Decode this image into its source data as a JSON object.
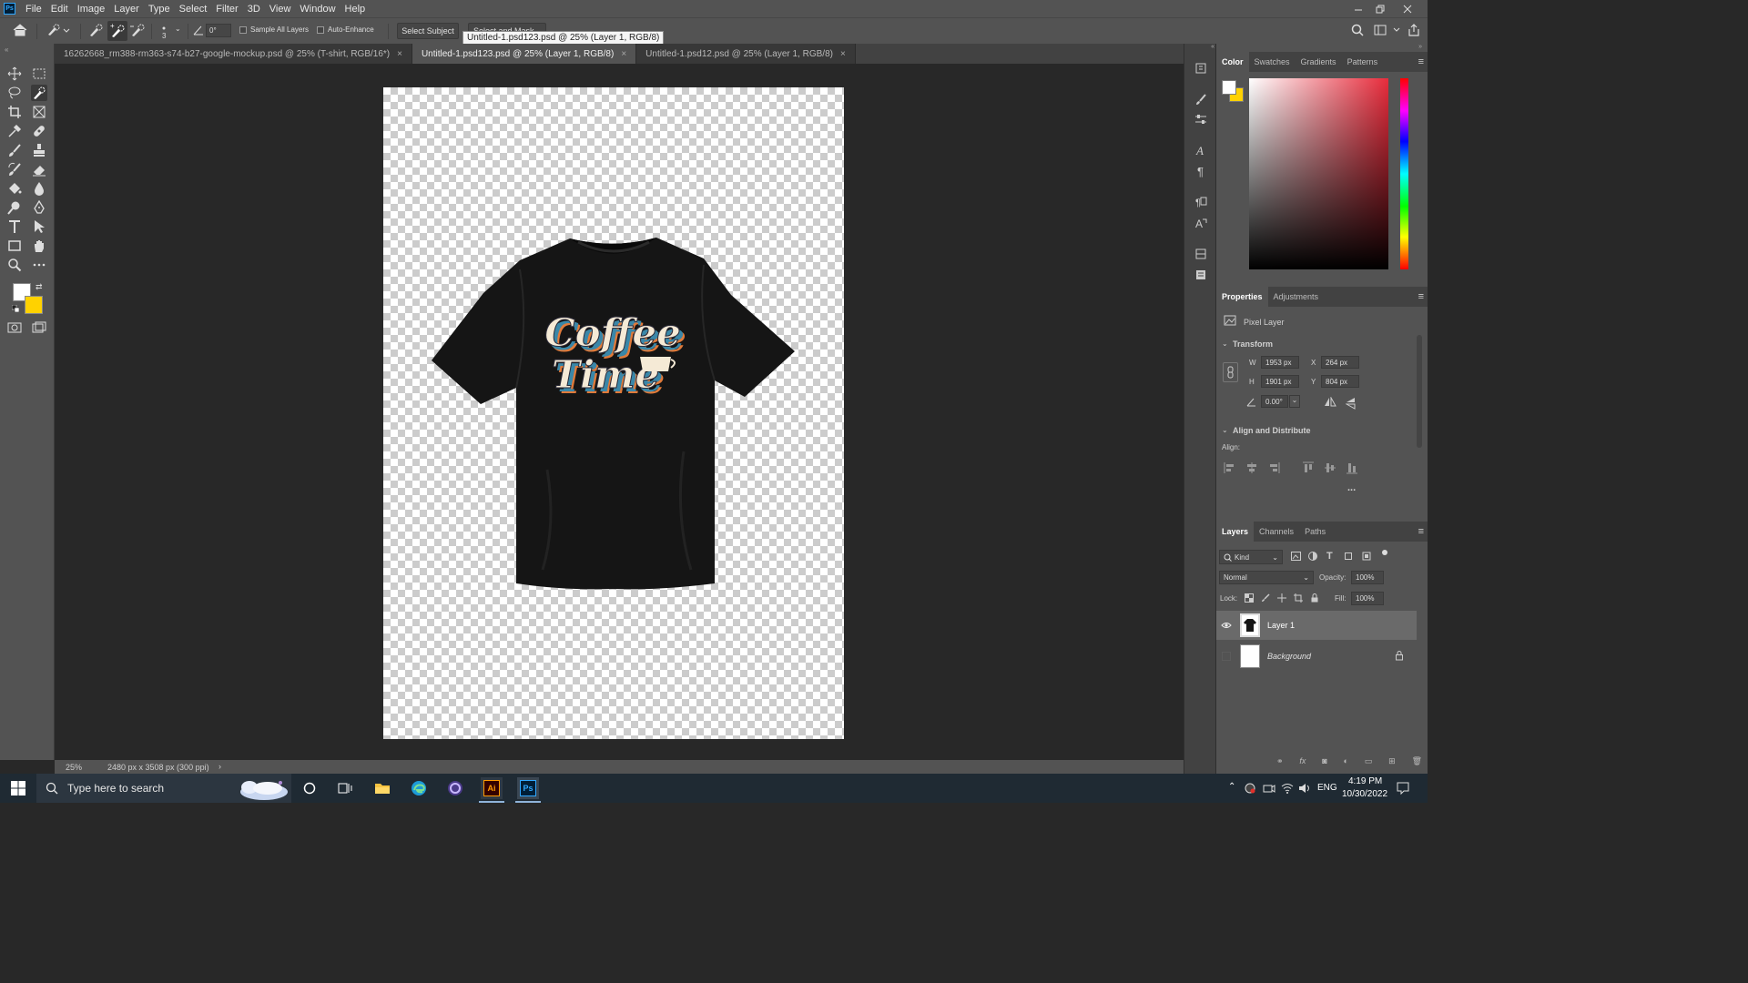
{
  "menubar": {
    "logo": "Ps",
    "items": [
      "File",
      "Edit",
      "Image",
      "Layer",
      "Type",
      "Select",
      "Filter",
      "3D",
      "View",
      "Window",
      "Help"
    ]
  },
  "options": {
    "brush_size": "3",
    "angle": "0°",
    "sample_all_layers": "Sample All Layers",
    "auto_enhance": "Auto-Enhance",
    "select_subject": "Select Subject",
    "select_and_mask": "Select and Mask..."
  },
  "tooltip": "Untitled-1.psd123.psd @ 25% (Layer 1, RGB/8)",
  "tabs": [
    {
      "label": "16262668_rm388-rm363-s74-b27-google-mockup.psd @ 25% (T-shirt, RGB/16*)",
      "close": "×"
    },
    {
      "label": "Untitled-1.psd123.psd @ 25% (Layer 1, RGB/8)",
      "close": "×"
    },
    {
      "label": "Untitled-1.psd12.psd @ 25% (Layer 1, RGB/8)",
      "close": "×"
    }
  ],
  "artwork": {
    "line1": "Coffee",
    "line2": "Time"
  },
  "status": {
    "zoom": "25%",
    "doc_info": "2480 px x 3508 px (300 ppi)",
    "arrow": "›"
  },
  "color_panel": {
    "tabs": [
      "Color",
      "Swatches",
      "Gradients",
      "Patterns"
    ],
    "fg_color": "#ffffff",
    "bg_color": "#ffd200",
    "hue": "#e82c3c"
  },
  "properties": {
    "tabs": [
      "Properties",
      "Adjustments"
    ],
    "layer_type": "Pixel Layer",
    "transform_title": "Transform",
    "w_label": "W",
    "w": "1953 px",
    "h_label": "H",
    "h": "1901 px",
    "x_label": "X",
    "x": "264 px",
    "y_label": "Y",
    "y": "804 px",
    "angle": "0.00°",
    "align_title": "Align and Distribute",
    "align_label": "Align:",
    "more": "..."
  },
  "layers_panel": {
    "tabs": [
      "Layers",
      "Channels",
      "Paths"
    ],
    "kind": "Kind",
    "blend_mode": "Normal",
    "opacity_label": "Opacity:",
    "opacity": "100%",
    "lock_label": "Lock:",
    "fill_label": "Fill:",
    "fill": "100%",
    "layers": [
      {
        "name": "Layer 1"
      },
      {
        "name": "Background"
      }
    ]
  },
  "taskbar": {
    "search_placeholder": "Type here to search",
    "lang": "ENG",
    "time": "4:19 PM",
    "date": "10/30/2022",
    "ai_label": "Ai",
    "ps_label": "Ps"
  }
}
